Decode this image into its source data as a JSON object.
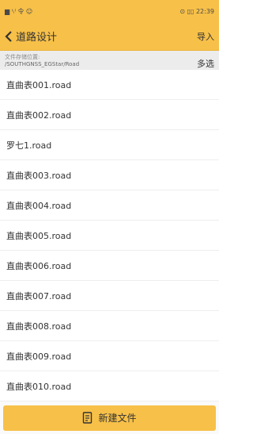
{
  "status_bar": {
    "left_text": "▆ ᵗᵢˡ 令 ☺",
    "right_text": "⊙ ▯▯ 22:39"
  },
  "header": {
    "title": "道路设计",
    "import_label": "导入"
  },
  "path": {
    "label": "文件存储位置:",
    "value": "/SOUTHGNSS_EGStar/Road",
    "multi_select_label": "多选"
  },
  "files": [
    "直曲表001.road",
    "直曲表002.road",
    "罗七1.road",
    "直曲表003.road",
    "直曲表004.road",
    "直曲表005.road",
    "直曲表006.road",
    "直曲表007.road",
    "直曲表008.road",
    "直曲表009.road",
    "直曲表010.road"
  ],
  "footer": {
    "new_file_label": "新建文件"
  },
  "colors": {
    "accent": "#f7c048"
  }
}
